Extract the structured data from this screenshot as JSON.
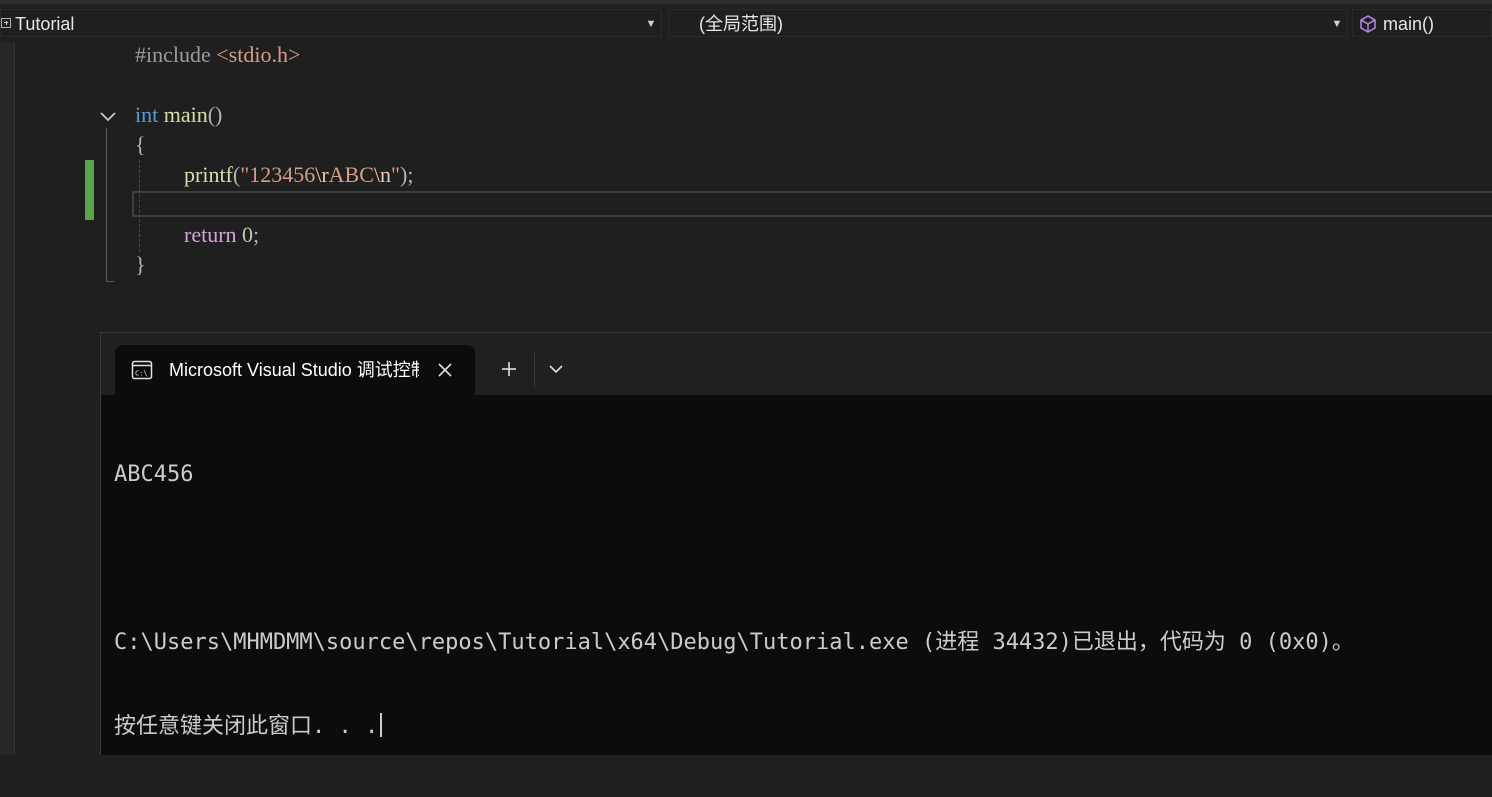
{
  "navbar": {
    "project": "Tutorial",
    "scope": "(全局范围)",
    "member": "main()"
  },
  "editor": {
    "lines": [
      {
        "include_kw": "#include",
        "include_file": " <stdio.h>"
      },
      {
        "type_kw": "int",
        "fn_name": " main",
        "parens": "()"
      },
      {
        "brace_open": "{"
      },
      {
        "fn": "printf",
        "open": "(",
        "str_a": "\"123456",
        "esc_r": "\\r",
        "str_b": "ABC",
        "esc_n": "\\n",
        "str_c": "\"",
        "close": ");"
      },
      {
        "ret_kw": "return",
        "ret_val": " 0",
        "semi": ";"
      },
      {
        "brace_close": "}"
      }
    ]
  },
  "terminal": {
    "tab_title": "Microsoft Visual Studio 调试控制台",
    "output": [
      "ABC456",
      "",
      "C:\\Users\\MHMDMM\\source\\repos\\Tutorial\\x64\\Debug\\Tutorial.exe (进程 34432)已退出，代码为 0 (0x0)。",
      "按任意键关闭此窗口. . ."
    ]
  },
  "colors": {
    "change_marker": "#57a64a",
    "keyword": "#569cd6",
    "control_keyword": "#d8a0df",
    "function": "#dcdcaa",
    "string": "#d69d85"
  }
}
